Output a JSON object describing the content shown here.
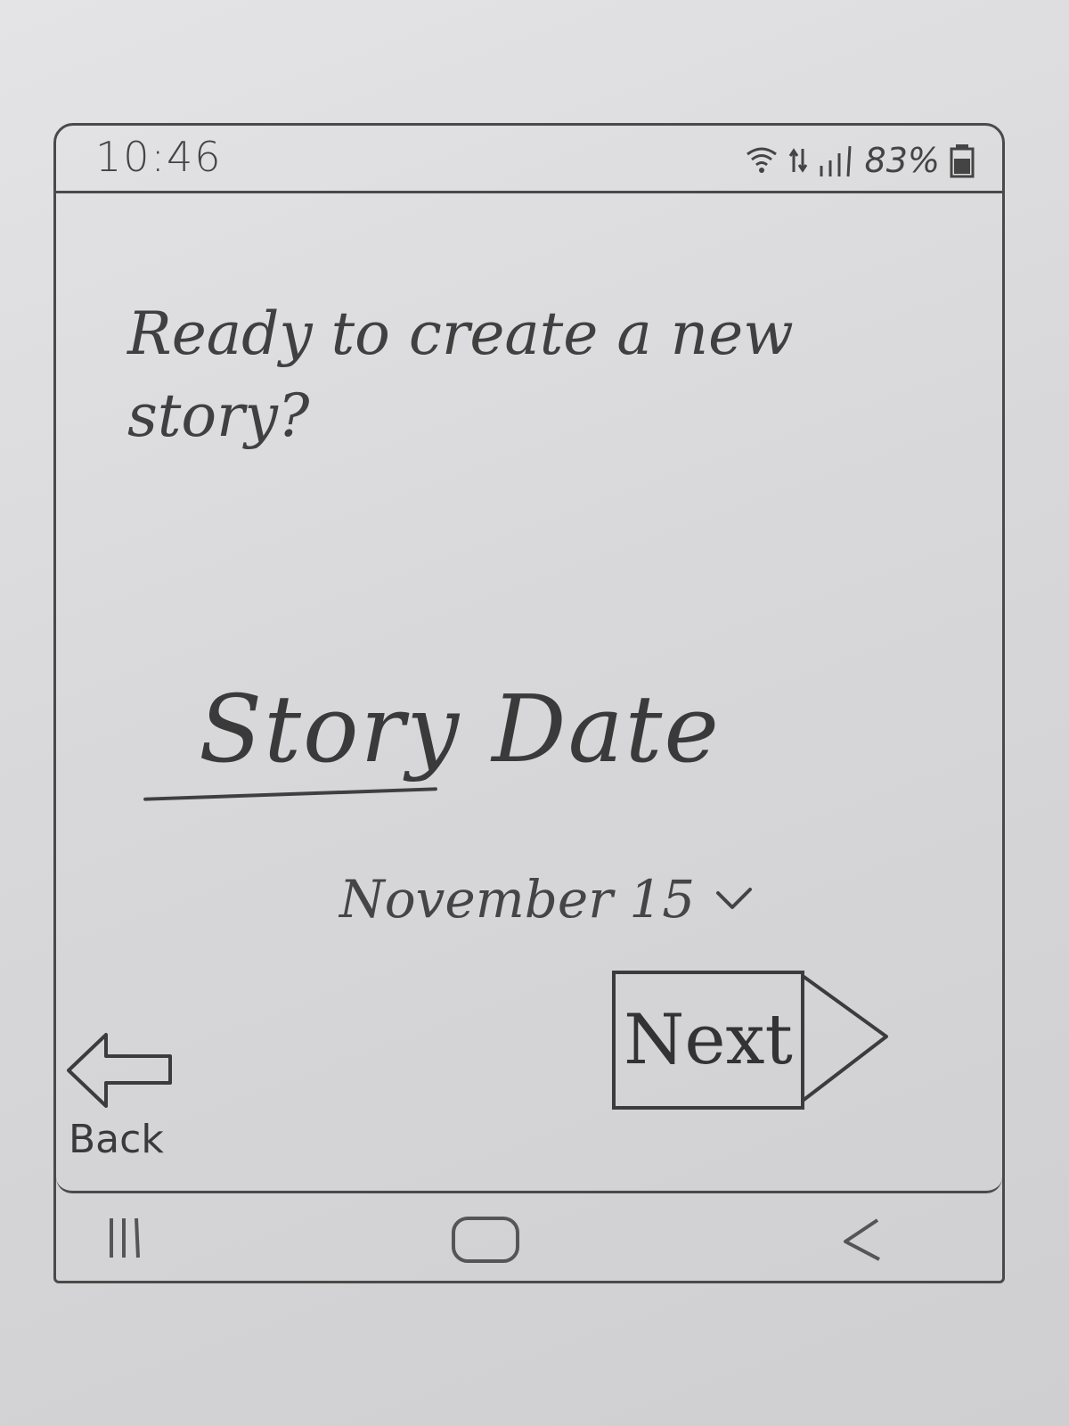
{
  "status_bar": {
    "time": "10:46",
    "battery": "83%",
    "icons": [
      "wifi-icon",
      "data-arrows-icon",
      "signal-icon",
      "battery-icon"
    ]
  },
  "screen": {
    "headline": "Ready to create a new story?",
    "date_field": {
      "label": "Story Date",
      "value": "November 15"
    },
    "next_button": {
      "label": "Next"
    },
    "back_button": {
      "label": "Back"
    }
  },
  "nav_bar": {
    "icons": [
      "recents-icon",
      "home-icon",
      "back-chevron-icon"
    ]
  },
  "colors": {
    "paper": "#d9d9db",
    "pencil": "#3c3c3c"
  }
}
